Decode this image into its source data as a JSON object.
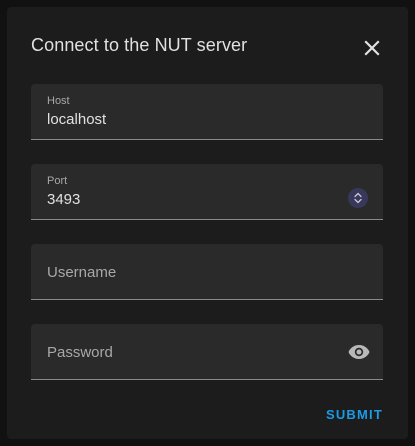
{
  "dialog": {
    "title": "Connect to the NUT server",
    "close_icon": "close-icon"
  },
  "fields": {
    "host": {
      "label": "Host",
      "value": "localhost"
    },
    "port": {
      "label": "Port",
      "value": "3493",
      "icon": "stepper-icon"
    },
    "username": {
      "placeholder": "Username",
      "value": ""
    },
    "password": {
      "placeholder": "Password",
      "value": "",
      "icon": "eye-icon"
    }
  },
  "actions": {
    "submit_label": "SUBMIT"
  },
  "colors": {
    "background": "#1c1c1c",
    "field_background": "#2a2a2a",
    "accent": "#1a9be6"
  }
}
